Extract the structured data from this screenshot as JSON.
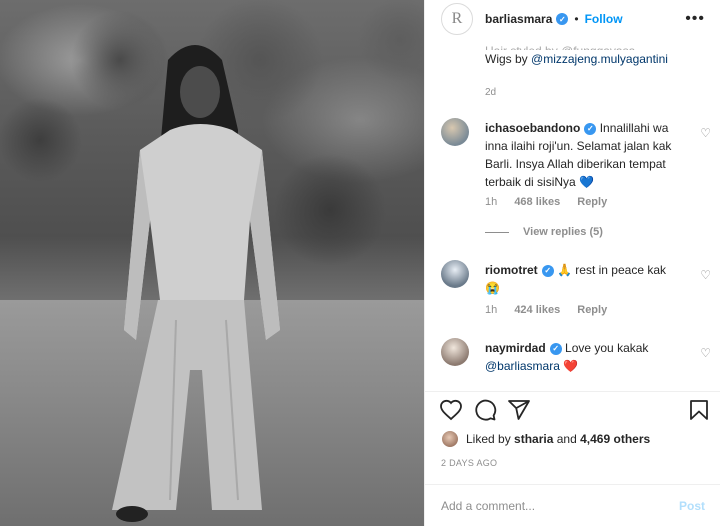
{
  "header": {
    "username": "barliasmara",
    "follow_label": "Follow",
    "logo_glyph": "R",
    "more_glyph": "•••"
  },
  "caption": {
    "cut_line": "Hair styled by @funggayasa",
    "wigs_prefix": "Wigs by",
    "wigs_mention": "@mizzajeng.mulyagantini",
    "time": "2d"
  },
  "comments": [
    {
      "username": "ichasoebandono",
      "text": "Innalillahi wa inna ilaihi roji'un. Selamat jalan kak Barli. Insya Allah diberikan tempat terbaik di sisiNya",
      "emoji": "💙",
      "time": "1h",
      "likes": "468 likes",
      "reply": "Reply"
    },
    {
      "username": "riomotret",
      "text": "🙏 rest in peace kak",
      "emoji": "😭",
      "time": "1h",
      "likes": "424 likes",
      "reply": "Reply"
    },
    {
      "username": "naymirdad",
      "text": "Love you kakak",
      "mention": "@barliasmara",
      "emoji": "❤️"
    }
  ],
  "view_replies": "View replies (5)",
  "likes": {
    "prefix": "Liked by",
    "user": "stharia",
    "connector": "and",
    "others": "4,469 others"
  },
  "posted_time": "2 DAYS AGO",
  "add_comment": {
    "placeholder": "Add a comment...",
    "post_label": "Post"
  },
  "colors": {
    "accent": "#0095f6",
    "verified": "#3897f0",
    "post_disabled": "#b2dffc",
    "muted": "#8e8e8e"
  },
  "icons": [
    "heart-icon",
    "comment-icon",
    "share-icon",
    "bookmark-icon",
    "verified-icon",
    "more-icon"
  ]
}
